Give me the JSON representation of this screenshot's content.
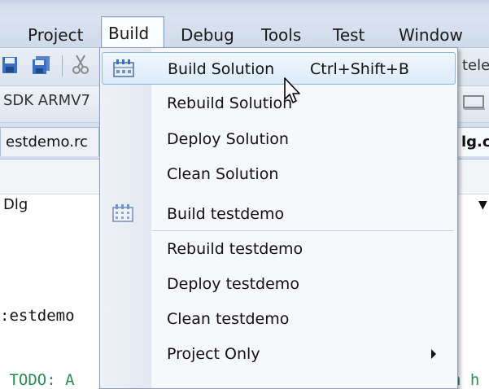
{
  "menubar": {
    "items": [
      {
        "label": "Project"
      },
      {
        "label": "Build"
      },
      {
        "label": "Debug"
      },
      {
        "label": "Tools"
      },
      {
        "label": "Test"
      },
      {
        "label": "Window"
      }
    ]
  },
  "background": {
    "toolbar_config": "SDK ARMV7",
    "toolbar_right": "tele",
    "tab_left": "estdemo.rc",
    "tab_right": "lg.c",
    "combo_value": "Dlg",
    "code_lines": [
      {
        "text": ":estdemo"
      },
      {
        "text": " TODO: A"
      },
      {
        "text": "n h"
      }
    ]
  },
  "build_menu": {
    "items": [
      {
        "label": "Build Solution",
        "shortcut": "Ctrl+Shift+B",
        "icon": "build-solution-icon",
        "highlighted": true
      },
      {
        "label": "Rebuild Solution"
      },
      {
        "label": "Deploy Solution"
      },
      {
        "label": "Clean Solution"
      },
      {
        "label": "Build testdemo",
        "icon": "build-project-icon"
      },
      {
        "label": "Rebuild testdemo"
      },
      {
        "label": "Deploy testdemo"
      },
      {
        "label": "Clean testdemo"
      },
      {
        "label": "Project Only",
        "submenu": true
      }
    ]
  },
  "colors": {
    "menu_highlight_border": "#8fb7e0",
    "menubar_bg": "#d2ddec",
    "code_green": "#2e8b57"
  }
}
